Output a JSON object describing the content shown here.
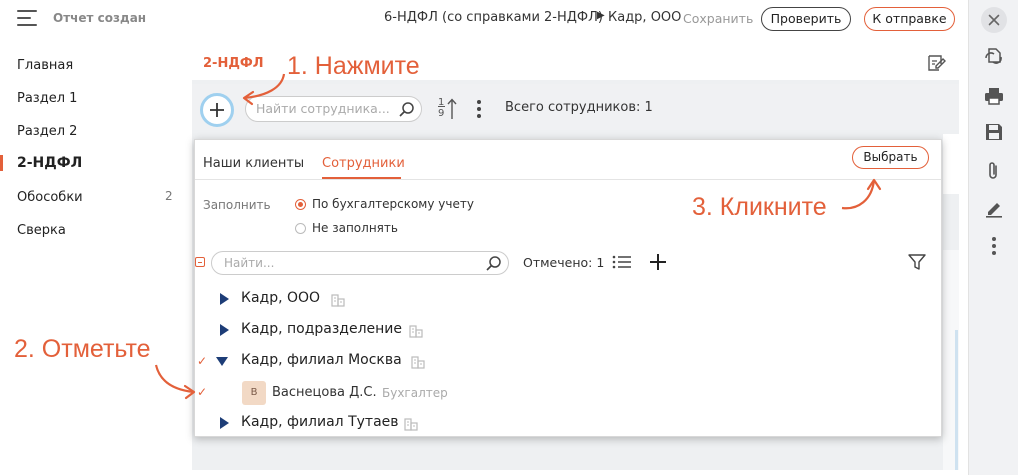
{
  "header": {
    "status": "Отчет создан",
    "doc_title": "6-НДФЛ (со справками 2-НДФЛ)",
    "breadcrumb_arrow": "▶",
    "org": "Кадр, ООО",
    "save_label": "Сохранить",
    "check_label": "Проверить",
    "send_label": "К отправке"
  },
  "sidebar": {
    "items": [
      {
        "label": "Главная"
      },
      {
        "label": "Раздел 1"
      },
      {
        "label": "Раздел 2"
      },
      {
        "label": "2-НДФЛ",
        "active": true
      },
      {
        "label": "Обособки",
        "count": "2"
      },
      {
        "label": "Сверка"
      }
    ]
  },
  "right_toolbar": {
    "icons": [
      "close-icon",
      "sync-icon",
      "print-icon",
      "save-disk-icon",
      "paperclip-icon",
      "sign-icon",
      "more-vertical-icon"
    ]
  },
  "main": {
    "section_label": "2-НДФЛ",
    "search_placeholder": "Найти сотрудника...",
    "sort_top": "1",
    "sort_bottom": "9",
    "total_employees": "Всего сотрудников: 1"
  },
  "popup": {
    "tabs": [
      "Наши клиенты",
      "Сотрудники"
    ],
    "active_tab": "Сотрудники",
    "choose_label": "Выбрать",
    "fill_label": "Заполнить",
    "fill_options": [
      {
        "label": "По бухгалтерскому учету",
        "selected": true
      },
      {
        "label": "Не заполнять",
        "selected": false
      }
    ],
    "search_placeholder": "Найти...",
    "marked_count": "Отмечено: 1",
    "tree": [
      {
        "label": "Кадр, ООО",
        "expanded": false,
        "checked": false
      },
      {
        "label": "Кадр, подразделение",
        "expanded": false,
        "checked": false
      },
      {
        "label": "Кадр, филиал Москва",
        "expanded": true,
        "checked": true
      },
      {
        "label": "Кадр, филиал Тутаев",
        "expanded": false,
        "checked": false
      }
    ],
    "employee": {
      "initial": "В",
      "name": "Васнецова Д.С.",
      "role": "Бухгалтер",
      "checked": true
    }
  },
  "annotations": {
    "step1": "1. Нажмите",
    "step2": "2. Отметьте",
    "step3": "3. Кликните"
  },
  "colors": {
    "accent": "#e3603a",
    "tree_triangle": "#1d3d77",
    "plus_ring": "#9fd0ef"
  }
}
